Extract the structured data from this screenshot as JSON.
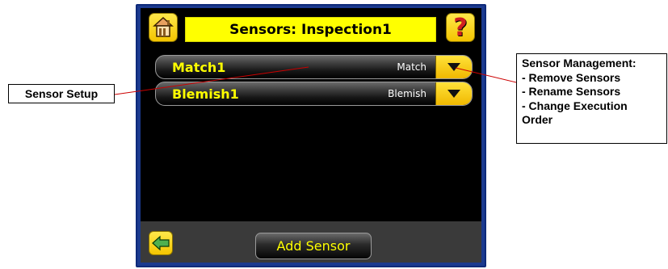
{
  "screen": {
    "title": "Sensors: Inspection1",
    "help_glyph": "?",
    "icons": {
      "home": "home-icon",
      "help": "help-icon",
      "back": "back-arrow-icon",
      "row_menu": "dropdown-triangle-icon"
    },
    "sensors": [
      {
        "name": "Match1",
        "type": "Match"
      },
      {
        "name": "Blemish1",
        "type": "Blemish"
      }
    ],
    "add_sensor_label": "Add Sensor"
  },
  "callouts": {
    "sensor_setup": "Sensor Setup",
    "sensor_management": {
      "heading": "Sensor Management:",
      "items": [
        "- Remove Sensors",
        "- Rename Sensors",
        "- Change Execution",
        "Order"
      ]
    }
  },
  "colors": {
    "frame": "#1b3a8f",
    "accent_yellow": "#ffff00",
    "button_yellow": "#f4c400",
    "leader_line": "#cc0000"
  }
}
